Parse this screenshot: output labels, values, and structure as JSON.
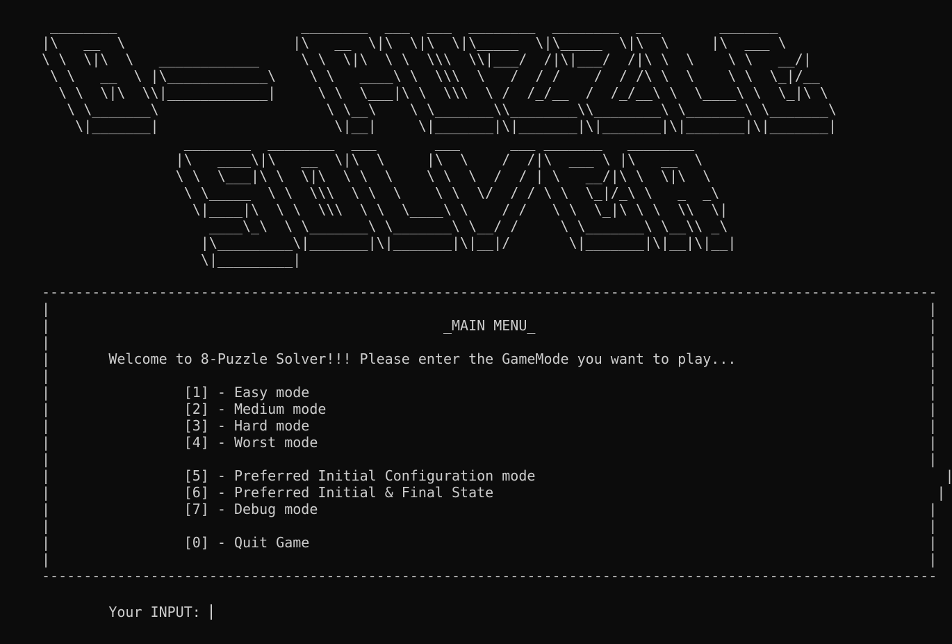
{
  "banner": {
    "art_lines": [
      " ________                      ________  ___  ___  ________  ________  ___       _______",
      "|\\   __  \\                    |\\   __  \\|\\  \\|\\  \\|\\_____  \\|\\_____  \\|\\  \\     |\\  ___ \\",
      "\\ \\  \\|\\  \\   ____________     \\ \\  \\|\\  \\ \\  \\\\\\  \\\\|___/  /|\\|___/  /|\\ \\  \\    \\ \\   __/|",
      " \\ \\   __  \\ |\\____________\\    \\ \\   ____\\ \\  \\\\\\  \\   /  / /    /  / /\\ \\  \\    \\ \\  \\_|/__",
      "  \\ \\  \\|\\  \\\\|____________|     \\ \\  \\___|\\ \\  \\\\\\  \\ /  /_/__  /  /_/__\\ \\  \\____\\ \\  \\_|\\ \\",
      "   \\ \\_______\\                    \\ \\__\\    \\ \\_______\\\\________\\\\________\\ \\_______\\ \\_______\\",
      "    \\|_______|                     \\|__|     \\|_______|\\|_______|\\|_______|\\|_______|\\|_______|",
      "                 ________  ________  ___       ___      ___ _______   ________",
      "                |\\   ____\\|\\   __  \\|\\  \\     |\\  \\    /  /|\\  ___ \\ |\\   __  \\",
      "                \\ \\  \\___|\\ \\  \\|\\  \\ \\  \\    \\ \\  \\  /  / | \\   __/|\\ \\  \\|\\  \\",
      "                 \\ \\_____  \\ \\  \\\\\\  \\ \\  \\    \\ \\  \\/  / / \\ \\  \\_|/_\\ \\   _  _\\",
      "                  \\|____|\\  \\ \\  \\\\\\  \\ \\  \\____\\ \\    / /   \\ \\  \\_|\\ \\ \\  \\\\  \\|",
      "                    ____\\_\\  \\ \\_______\\ \\_______\\ \\__/ /     \\ \\_______\\ \\__\\\\ _\\",
      "                   |\\_________\\|_______|\\|_______|\\|__|/       \\|_______|\\|__|\\|__|",
      "                   \\|_________|"
    ]
  },
  "menu": {
    "border": "-----------------------------------------------------------------------------------------------------------",
    "title": "_MAIN MENU_",
    "welcome": "Welcome to 8-Puzzle Solver!!! Please enter the GameMode you want to play...",
    "options": [
      "[1] - Easy mode",
      "[2] - Medium mode",
      "[3] - Hard mode",
      "[4] - Worst mode",
      "[5] - Preferred Initial Configuration mode",
      "[6] - Preferred Initial & Final State",
      "[7] - Debug mode",
      "[0] - Quit Game"
    ]
  },
  "prompt": {
    "label": "Your INPUT:"
  }
}
